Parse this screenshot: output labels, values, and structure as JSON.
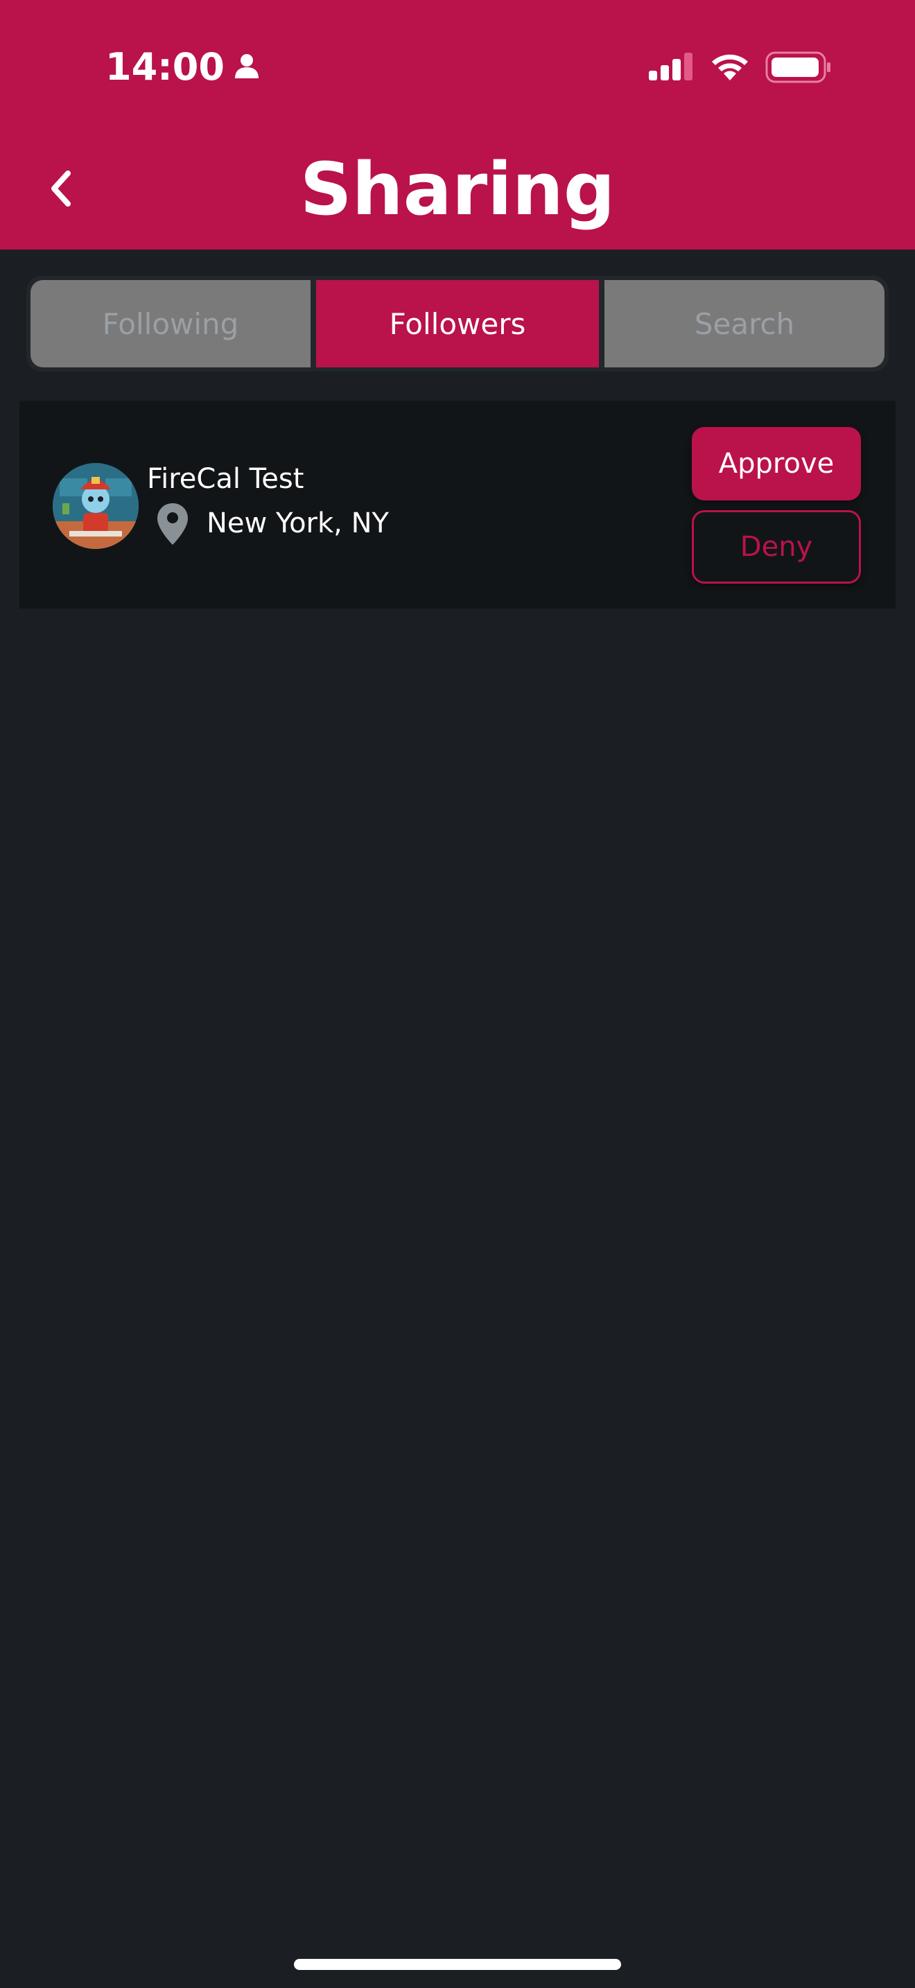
{
  "status_bar": {
    "time": "14:00",
    "icons": [
      "person-icon",
      "signal-icon",
      "wifi-icon",
      "battery-icon"
    ]
  },
  "header": {
    "title": "Sharing",
    "back_icon": "chevron-left-icon",
    "background_color": "#ba124a"
  },
  "tabs": [
    {
      "label": "Following",
      "selected": false
    },
    {
      "label": "Followers",
      "selected": true
    },
    {
      "label": "Search",
      "selected": false
    }
  ],
  "requests": [
    {
      "name": "FireCal Test",
      "location": "New York, NY",
      "location_icon": "map-pin-icon",
      "approve_label": "Approve",
      "deny_label": "Deny"
    }
  ],
  "colors": {
    "accent": "#ba124a",
    "background": "#1b1f23",
    "card": "#121518",
    "inactive_tab": "#7a7a7a"
  }
}
